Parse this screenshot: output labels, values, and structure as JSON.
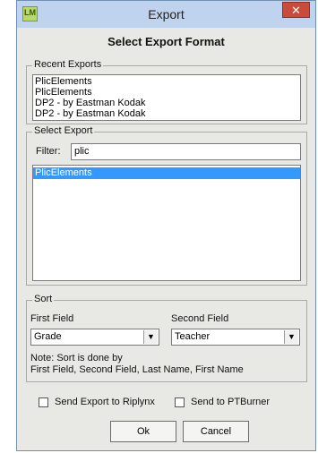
{
  "window": {
    "title": "Export",
    "close_glyph": "✕",
    "app_icon": "LM",
    "heading": "Select Export Format"
  },
  "recent": {
    "label": "Recent Exports",
    "items": [
      "PlicElements",
      "PlicElements",
      "DP2  -  by Eastman Kodak",
      "DP2  -  by Eastman Kodak"
    ]
  },
  "select": {
    "label": "Select Export",
    "filter_label": "Filter:",
    "filter_value": "plic",
    "items": [
      "PlicElements"
    ],
    "selected_index": 0
  },
  "sort": {
    "label": "Sort",
    "first_label": "First Field",
    "second_label": "Second Field",
    "first_value": "Grade",
    "second_value": "Teacher",
    "note_line1": "Note: Sort is done by",
    "note_line2": "First Field, Second Field, Last Name, First Name"
  },
  "options": {
    "riplynx_label": "Send Export to Riplynx",
    "ptburner_label": "Send to PTBurner"
  },
  "buttons": {
    "ok_label": "Ok",
    "cancel_label": "Cancel"
  },
  "colors": {
    "titlebar": "#bfd2ee",
    "selection": "#3399ff",
    "close": "#c94b3a"
  }
}
